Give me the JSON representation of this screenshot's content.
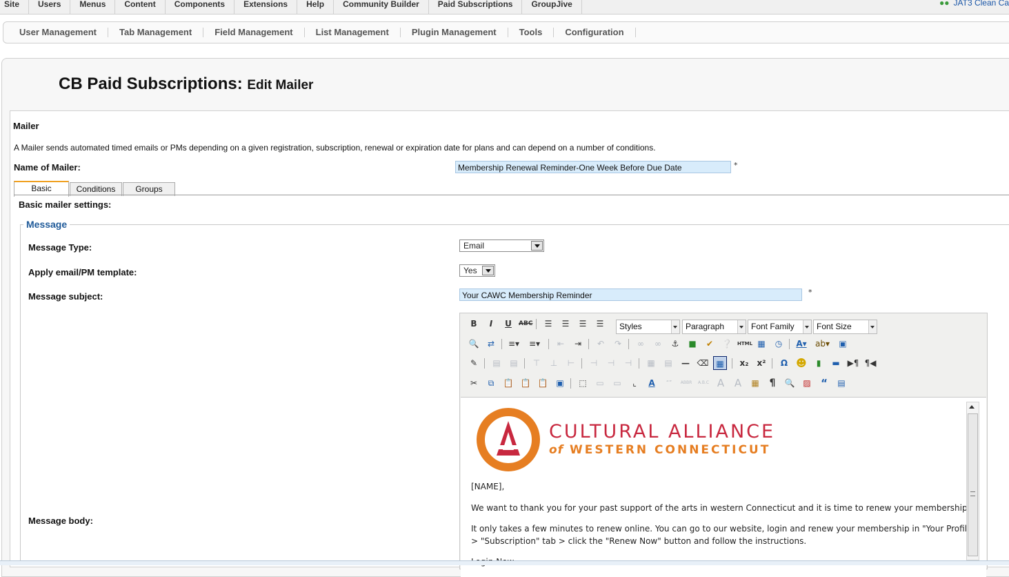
{
  "top_menu": {
    "items": [
      "Site",
      "Users",
      "Menus",
      "Content",
      "Components",
      "Extensions",
      "Help",
      "Community Builder",
      "Paid Subscriptions",
      "GroupJive"
    ],
    "right_link": "JAT3 Clean Ca"
  },
  "sub_menu": {
    "items": [
      "User Management",
      "Tab Management",
      "Field Management",
      "List Management",
      "Plugin Management",
      "Tools",
      "Configuration"
    ]
  },
  "page": {
    "title_main": "CB Paid Subscriptions:",
    "title_sub": "Edit Mailer"
  },
  "form": {
    "section_label": "Mailer",
    "description": "A Mailer sends automated timed emails or PMs depending on a given registration, subscription, renewal or expiration date for plans and can depend on a number of conditions.",
    "name_label": "Name of Mailer:",
    "name_value": "Membership Renewal Reminder-One Week Before Due Date",
    "required_mark": "*"
  },
  "tabs": {
    "items": [
      "Basic",
      "Conditions",
      "Groups"
    ],
    "active": "Basic"
  },
  "basic": {
    "heading": "Basic mailer settings:",
    "fieldset_legend": "Message",
    "message_type_label": "Message Type:",
    "message_type_value": "Email",
    "apply_template_label": "Apply email/PM template:",
    "apply_template_value": "Yes",
    "subject_label": "Message subject:",
    "subject_value": "Your CAWC Membership Reminder",
    "body_label": "Message body:"
  },
  "editor": {
    "dropdowns": {
      "styles": "Styles",
      "paragraph": "Paragraph",
      "font_family": "Font Family",
      "font_size": "Font Size"
    },
    "content": {
      "logo_title": "CULTURAL ALLIANCE",
      "logo_of": "of",
      "logo_sub": "WESTERN CONNECTICUT",
      "greeting": "[NAME],",
      "paragraph1": "We want to thank you for your past support of the arts in western Connecticut and it is time to renew your membership.",
      "paragraph2a": "It only takes a few minutes to renew online. You can go to our website, login and renew your membership in \"Your Profile\"",
      "paragraph2b": "> \"Subscription\" tab > click the \"Renew Now\" button and follow the instructions.",
      "paragraph3": "Login Now"
    }
  },
  "colors": {
    "input_bg": "#d8ecfb",
    "legend": "#1f5a99",
    "logo_red": "#c8283f",
    "logo_orange": "#e67e22",
    "tab_accent": "#f0a020"
  }
}
